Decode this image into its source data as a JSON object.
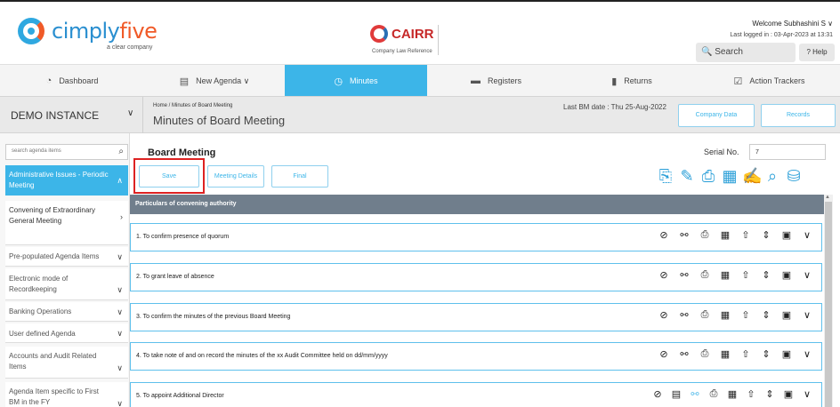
{
  "header": {
    "logo_text_a": "cimply",
    "logo_text_b": "five",
    "logo_sub": "a clear company",
    "cairr_text": "CAIRR",
    "cairr_sub": "Company Law Reference",
    "welcome": "Welcome Subhashini  S  ∨",
    "last_login": "Last logged in : 03-Apr-2023 at 13:31",
    "search_placeholder": "🔍 Search",
    "help": "? Help"
  },
  "nav": {
    "items": [
      {
        "label": "Dashboard",
        "icon": "dashboard-icon"
      },
      {
        "label": "New Agenda  ∨",
        "icon": "list-icon"
      },
      {
        "label": "Minutes",
        "icon": "clock-icon"
      },
      {
        "label": "Registers",
        "icon": "folder-icon"
      },
      {
        "label": "Returns",
        "icon": "document-icon"
      },
      {
        "label": "Action Trackers",
        "icon": "checklist-icon"
      }
    ],
    "active_index": 2
  },
  "instance": {
    "name": "DEMO INSTANCE",
    "breadcrumb": "Home  /  Minutes of Board Meeting",
    "page_title": "Minutes of Board Meeting",
    "bm_date": "Last BM date : Thu 25-Aug-2022",
    "company_data": "Company Data",
    "records": "Records"
  },
  "sidebar": {
    "search_placeholder": "search agenda items",
    "items": [
      {
        "label": "Administrative Issues - Periodic Meeting",
        "active": true
      },
      {
        "label": "Convening of Extraordinary General Meeting"
      },
      {
        "label": "Pre-populated Agenda Items"
      },
      {
        "label": "Electronic mode of Recordkeeping"
      },
      {
        "label": "Banking Operations"
      },
      {
        "label": "User defined Agenda"
      },
      {
        "label": "Accounts and Audit Related Items"
      },
      {
        "label": "Agenda Item specific to First BM in the FY"
      }
    ]
  },
  "main": {
    "title": "Board Meeting",
    "serial_label": "Serial No.",
    "serial_value": "7",
    "save": "Save",
    "meeting_details": "Meeting Details",
    "final": "Final",
    "section_header": "Particulars of convening authority",
    "agenda_items": [
      "1.   To confirm presence of quorum",
      "2.   To grant leave of absence",
      "3.   To confirm the minutes of the previous Board Meeting",
      "4.   To take note of and on record the minutes of the xx Audit Committee held on dd/mm/yyyy",
      "5.   To appoint Additional Director"
    ]
  },
  "colors": {
    "accent": "#3cb5e8",
    "band": "#707e8c",
    "highlight": "#dd2222"
  }
}
